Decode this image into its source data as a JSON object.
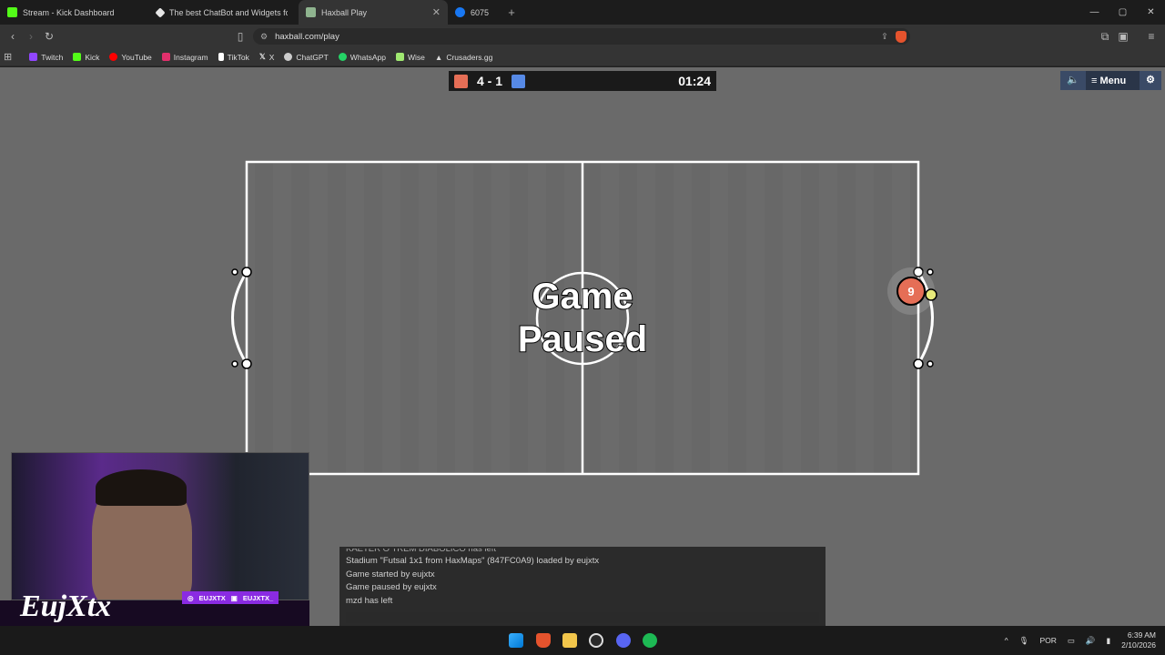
{
  "tabs": [
    {
      "title": "Stream - Kick Dashboard",
      "icon": "kick-icon",
      "color": "#53fc18",
      "active": false
    },
    {
      "title": "The best ChatBot and Widgets for Ki",
      "icon": "botrix-icon",
      "color": "#e6e6e6",
      "active": false
    },
    {
      "title": "Haxball Play",
      "icon": "haxball-icon",
      "color": "#8fb48f",
      "active": true
    },
    {
      "title": "6075",
      "icon": "facebook-icon",
      "color": "#1877f2",
      "active": false
    }
  ],
  "address": {
    "url": "haxball.com/play"
  },
  "bookmarks": [
    {
      "label": "Twitch",
      "icon": "twitch-icon",
      "color": "#9146ff"
    },
    {
      "label": "Kick",
      "icon": "kick-icon",
      "color": "#53fc18"
    },
    {
      "label": "YouTube",
      "icon": "youtube-icon",
      "color": "#ff0000"
    },
    {
      "label": "Instagram",
      "icon": "instagram-icon",
      "color": "#e1306c"
    },
    {
      "label": "TikTok",
      "icon": "tiktok-icon",
      "color": "#ffffff"
    },
    {
      "label": "X",
      "icon": "x-icon",
      "color": "#ffffff"
    },
    {
      "label": "ChatGPT",
      "icon": "chatgpt-icon",
      "color": "#cccccc"
    },
    {
      "label": "WhatsApp",
      "icon": "whatsapp-icon",
      "color": "#25d366"
    },
    {
      "label": "Wise",
      "icon": "wise-icon",
      "color": "#9fe870"
    },
    {
      "label": "Crusaders.gg",
      "icon": "crusaders-icon",
      "color": "#dddddd"
    }
  ],
  "game": {
    "score": "4 - 1",
    "time": "01:24",
    "red_color": "#e56e56",
    "blue_color": "#5689e5",
    "menu_label": "Menu",
    "paused_line1": "Game",
    "paused_line2": "Paused",
    "player_number": "9"
  },
  "chat": {
    "messages": [
      "KAETER O TREM DIABOLICO has left",
      "Stadium \"Futsal 1x1 from HaxMaps\" (847FC0A9) loaded by eujxtx",
      "Game started by eujxtx",
      "Game paused by eujxtx",
      "mzd has left"
    ]
  },
  "stream": {
    "name": "EujXtx",
    "handle1": "EUJXTX",
    "handle2": "EUJXTX_"
  },
  "taskbar": {
    "lang": "POR",
    "time": "6:39 AM",
    "date": "2/10/2026"
  }
}
